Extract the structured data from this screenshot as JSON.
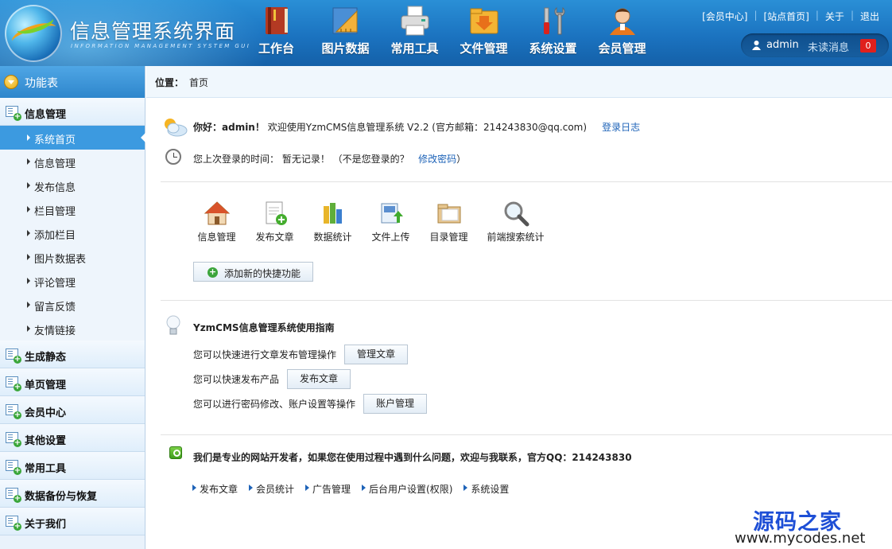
{
  "header": {
    "title": "信息管理系统界面",
    "subtitle": "INFORMATION MANAGEMENT SYSTEM GUI",
    "nav": [
      {
        "label": "工作台",
        "icon": "book-icon"
      },
      {
        "label": "图片数据",
        "icon": "ruler-icon"
      },
      {
        "label": "常用工具",
        "icon": "printer-icon"
      },
      {
        "label": "文件管理",
        "icon": "folder-download-icon"
      },
      {
        "label": "系统设置",
        "icon": "tools-icon"
      },
      {
        "label": "会员管理",
        "icon": "user-icon"
      }
    ],
    "links": [
      "[会员中心]",
      "[站点首页]",
      "关于",
      "退出"
    ],
    "user": {
      "name": "admin",
      "unread_label": "未读消息",
      "unread_count": "0"
    }
  },
  "sidebar": {
    "title": "功能表",
    "groups": [
      {
        "label": "信息管理",
        "items": [
          "系统首页",
          "信息管理",
          "发布信息",
          "栏目管理",
          "添加栏目",
          "图片数据表",
          "评论管理",
          "留言反馈",
          "友情链接"
        ]
      },
      {
        "label": "生成静态"
      },
      {
        "label": "单页管理"
      },
      {
        "label": "会员中心"
      },
      {
        "label": "其他设置"
      },
      {
        "label": "常用工具"
      },
      {
        "label": "数据备份与恢复"
      },
      {
        "label": "关于我们"
      }
    ],
    "active_item": "系统首页"
  },
  "breadcrumb": {
    "label": "位置：",
    "current": "首页"
  },
  "welcome": {
    "greeting": "你好：admin！",
    "text": "欢迎使用YzmCMS信息管理系统 V2.2 (官方邮箱：214243830@qq.com)",
    "log_link": "登录日志"
  },
  "last_login": {
    "text": "您上次登录的时间：  暂无记录！  （不是您登录的？",
    "change_pwd": "修改密码",
    "close": "）"
  },
  "quick": [
    {
      "label": "信息管理",
      "icon": "house-icon"
    },
    {
      "label": "发布文章",
      "icon": "add-document-icon"
    },
    {
      "label": "数据统计",
      "icon": "books-chart-icon"
    },
    {
      "label": "文件上传",
      "icon": "upload-file-icon"
    },
    {
      "label": "目录管理",
      "icon": "folder-icon"
    },
    {
      "label": "前端搜索统计",
      "icon": "magnifier-icon"
    }
  ],
  "add_quick": "添加新的快捷功能",
  "guide": {
    "title": "YzmCMS信息管理系统使用指南",
    "lines": [
      {
        "text": "您可以快速进行文章发布管理操作",
        "button": "管理文章"
      },
      {
        "text": "您可以快速发布产品",
        "button": "发布文章"
      },
      {
        "text": "您可以进行密码修改、账户设置等操作",
        "button": "账户管理"
      }
    ]
  },
  "contact": "我们是专业的网站开发者，如果您在使用过程中遇到什么问题，欢迎与我联系，官方QQ：214243830",
  "bottom_links": [
    "发布文章",
    "会员统计",
    "广告管理",
    "后台用户设置(权限)",
    "系统设置"
  ],
  "watermark": {
    "line1": "源码之家",
    "line2": "www.mycodes.net"
  },
  "colors": {
    "header": "#1b73c0",
    "active": "#3c9ae0",
    "link": "#1e63b8",
    "badge": "#e0201c"
  }
}
